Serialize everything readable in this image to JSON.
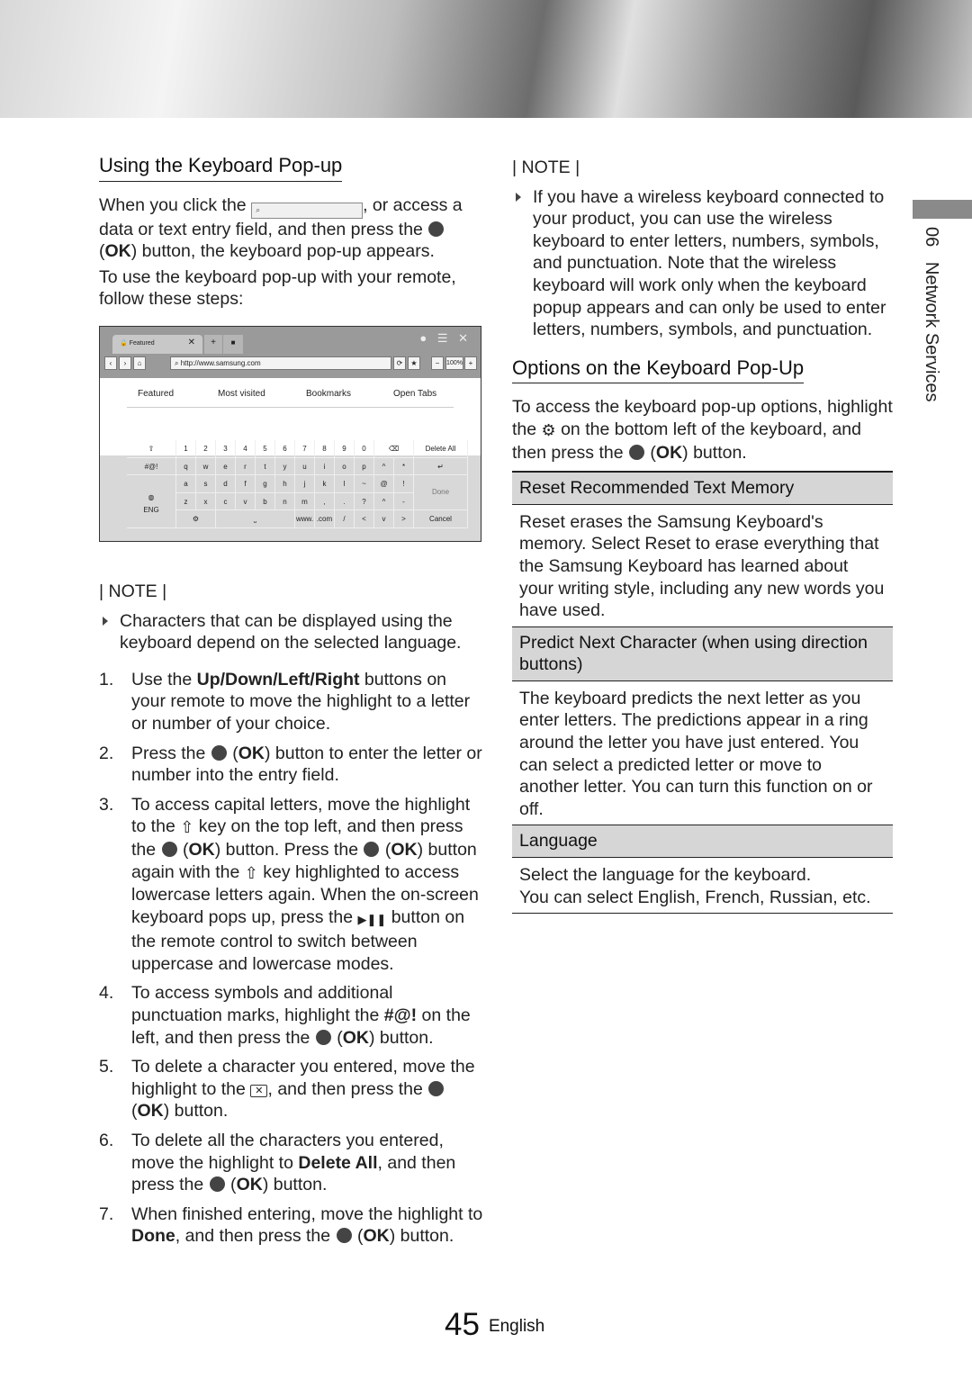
{
  "left": {
    "title": "Using the Keyboard Pop-up",
    "intro1": [
      "When you click the ",
      {
        "icon": "field"
      },
      ", or access a data or text entry field, and then press the ",
      {
        "icon": "ok"
      },
      " (",
      {
        "b": "OK"
      },
      ") button, the keyboard pop-up appears."
    ],
    "intro2": "To use the keyboard pop-up with your remote, follow these steps:",
    "note_heading": "| NOTE |",
    "notes": [
      "Characters that can be displayed using the keyboard depend on the selected language."
    ],
    "steps": [
      {
        "num": "1.",
        "text": [
          "Use the ",
          {
            "b": "Up/Down/Left/Right"
          },
          " buttons on your remote to move the highlight to a letter or number of your choice."
        ]
      },
      {
        "num": "2.",
        "text": [
          "Press the ",
          {
            "icon": "ok"
          },
          " (",
          {
            "b": "OK"
          },
          ") button to enter the letter or number into the entry field."
        ]
      },
      {
        "num": "3.",
        "text": [
          "To access capital letters, move the highlight to the ",
          {
            "icon": "shift"
          },
          " key on the top left, and then press the ",
          {
            "icon": "ok"
          },
          " (",
          {
            "b": "OK"
          },
          ") button. Press the ",
          {
            "icon": "ok"
          },
          " (",
          {
            "b": "OK"
          },
          ") button again with the ",
          {
            "icon": "shift"
          },
          " key highlighted to access lowercase letters again. When the on-screen keyboard pops up, press the ",
          {
            "icon": "play-pause"
          },
          " button on the remote control to switch between uppercase and lowercase modes."
        ]
      },
      {
        "num": "4.",
        "text": [
          "To access symbols and additional punctuation marks, highlight the ",
          {
            "b": "#@!"
          },
          " on the left, and then press the ",
          {
            "icon": "ok"
          },
          " (",
          {
            "b": "OK"
          },
          ") button."
        ]
      },
      {
        "num": "5.",
        "text": [
          "To delete a character you entered, move the highlight to the ",
          {
            "icon": "backspace"
          },
          ", and then press the ",
          {
            "icon": "ok"
          },
          " (",
          {
            "b": "OK"
          },
          ") button."
        ]
      },
      {
        "num": "6.",
        "text": [
          "To delete all the characters you entered, move the highlight to ",
          {
            "b": "Delete All"
          },
          ", and then press the ",
          {
            "icon": "ok"
          },
          " (",
          {
            "b": "OK"
          },
          ") button."
        ]
      },
      {
        "num": "7.",
        "text": [
          "When finished entering, move the highlight to ",
          {
            "b": "Done"
          },
          ", and then press the ",
          {
            "icon": "ok"
          },
          " (",
          {
            "b": "OK"
          },
          ") button."
        ]
      }
    ]
  },
  "screenshot": {
    "tab_label": "Featured",
    "url": "http://www.samsung.com",
    "zoom": "100%",
    "nav_tabs": [
      "Featured",
      "Most visited",
      "Bookmarks",
      "Open Tabs"
    ],
    "keys": [
      [
        "⇧",
        "1",
        "2",
        "3",
        "4",
        "5",
        "6",
        "7",
        "8",
        "9",
        "0",
        "⌫",
        "Delete All"
      ],
      [
        "#@!",
        "q",
        "w",
        "e",
        "r",
        "t",
        "y",
        "u",
        "i",
        "o",
        "p",
        "^",
        "*",
        "↵"
      ],
      [
        "ENG",
        "a",
        "s",
        "d",
        "f",
        "g",
        "h",
        "j",
        "k",
        "l",
        "~",
        "@",
        "!",
        "Done"
      ],
      [
        "z",
        "x",
        "c",
        "v",
        "b",
        "n",
        "m",
        ",",
        ".",
        "?",
        "^",
        "-"
      ],
      [
        "⚙",
        "⎵",
        "www.",
        ".com",
        "/",
        "<",
        "v",
        ">",
        "Cancel"
      ]
    ]
  },
  "right": {
    "note_heading": "| NOTE |",
    "notes": [
      "If you have a wireless keyboard connected to your product, you can use the wireless keyboard to enter letters, numbers, symbols, and punctuation. Note that the wireless keyboard will work only when the keyboard popup appears and can only be used to enter letters, numbers, symbols, and punctuation."
    ],
    "title": "Options on the Keyboard Pop-Up",
    "intro": [
      "To access the keyboard pop-up options, highlight the ",
      {
        "icon": "gear"
      },
      " on the bottom left of the keyboard, and then press the ",
      {
        "icon": "ok"
      },
      " (",
      {
        "b": "OK"
      },
      ") button."
    ],
    "options": [
      {
        "heading": "Reset Recommended Text Memory",
        "body": [
          "Reset erases the Samsung Keyboard's memory. Select Reset to erase everything that the Samsung Keyboard has learned about your writing style, including any new words you have used."
        ]
      },
      {
        "heading": "Predict Next Character (when using direction buttons)",
        "body": [
          "The keyboard predicts the next letter as you enter letters. The predictions appear in a ring around the letter you have just entered. You can select a predicted letter or move to another letter. You can turn this function on or off."
        ]
      },
      {
        "heading": "Language",
        "body": [
          "Select the language for the keyboard.",
          "You can select English, French, Russian, etc."
        ]
      }
    ]
  },
  "side_tab": "06   Network Services",
  "footer": {
    "page": "45",
    "language": "English"
  }
}
